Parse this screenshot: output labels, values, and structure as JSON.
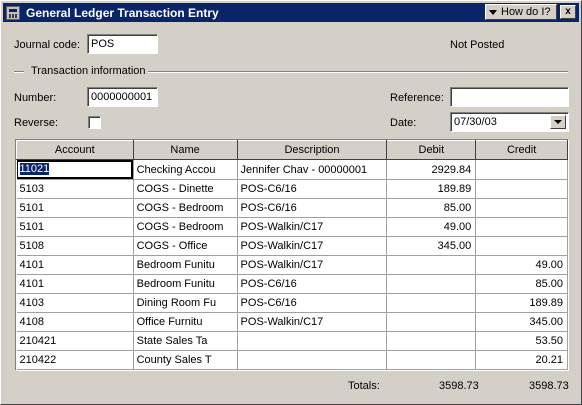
{
  "window": {
    "title": "General Ledger Transaction Entry",
    "help_label": "How do I?",
    "close_label": "x"
  },
  "journal": {
    "code_label": "Journal code:",
    "code_value": "POS",
    "status": "Not Posted"
  },
  "transaction": {
    "group_label": "Transaction information",
    "number_label": "Number:",
    "number_value": "0000000001",
    "reference_label": "Reference:",
    "reference_value": "",
    "reverse_label": "Reverse:",
    "reverse_checked": false,
    "date_label": "Date:",
    "date_value": "07/30/03"
  },
  "grid": {
    "columns": [
      "Account",
      "Name",
      "Description",
      "Debit",
      "Credit"
    ],
    "rows": [
      {
        "account": "11021",
        "name": "Checking Accou",
        "description": "Jennifer Chav - 00000001",
        "debit": "2929.84",
        "credit": ""
      },
      {
        "account": "5103",
        "name": "COGS - Dinette",
        "description": "POS-C6/16",
        "debit": "189.89",
        "credit": ""
      },
      {
        "account": "5101",
        "name": "COGS - Bedroom",
        "description": "POS-C6/16",
        "debit": "85.00",
        "credit": ""
      },
      {
        "account": "5101",
        "name": "COGS - Bedroom",
        "description": "POS-Walkin/C17",
        "debit": "49.00",
        "credit": ""
      },
      {
        "account": "5108",
        "name": "COGS - Office",
        "description": "POS-Walkin/C17",
        "debit": "345.00",
        "credit": ""
      },
      {
        "account": "4101",
        "name": "Bedroom Funitu",
        "description": "POS-Walkin/C17",
        "debit": "",
        "credit": "49.00"
      },
      {
        "account": "4101",
        "name": "Bedroom Funitu",
        "description": "POS-C6/16",
        "debit": "",
        "credit": "85.00"
      },
      {
        "account": "4103",
        "name": "Dining Room Fu",
        "description": "POS-C6/16",
        "debit": "",
        "credit": "189.89"
      },
      {
        "account": "4108",
        "name": "Office Furnitu",
        "description": "POS-Walkin/C17",
        "debit": "",
        "credit": "345.00"
      },
      {
        "account": "210421",
        "name": "State Sales Ta",
        "description": "",
        "debit": "",
        "credit": "53.50"
      },
      {
        "account": "210422",
        "name": "County Sales T",
        "description": "",
        "debit": "",
        "credit": "20.21"
      }
    ]
  },
  "totals": {
    "label": "Totals:",
    "debit": "3598.73",
    "credit": "3598.73"
  },
  "colors": {
    "titlebar": "#0a246a",
    "face": "#d4d0c8",
    "selection": "#0a246a"
  }
}
